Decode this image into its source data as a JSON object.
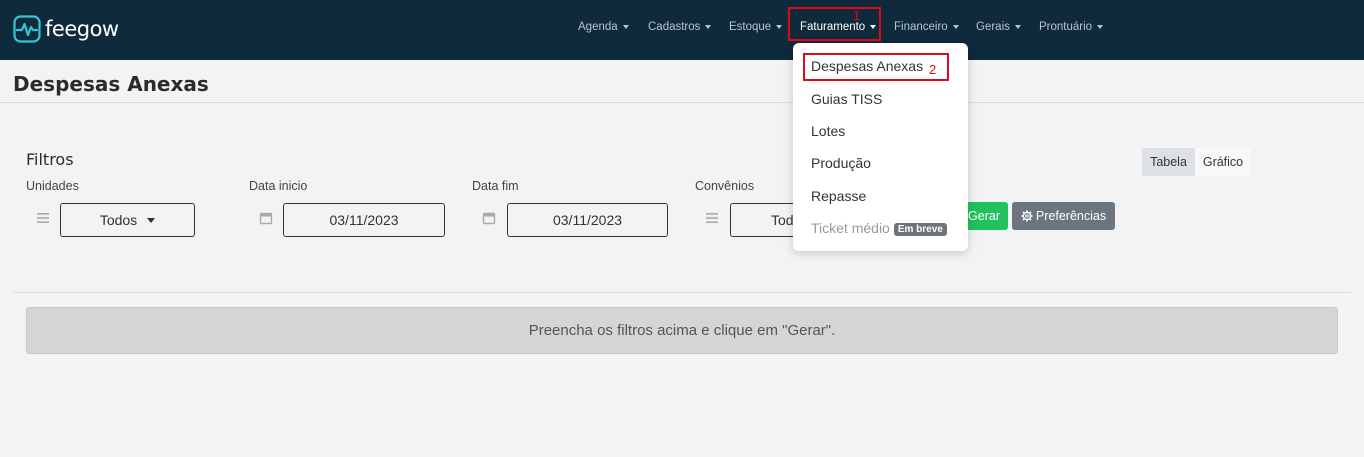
{
  "app": {
    "brand": "feegow"
  },
  "nav": {
    "items": [
      {
        "label": "Agenda",
        "active": false
      },
      {
        "label": "Cadastros",
        "active": false
      },
      {
        "label": "Estoque",
        "active": false
      },
      {
        "label": "Faturamento",
        "active": true
      },
      {
        "label": "Financeiro",
        "active": false
      },
      {
        "label": "Gerais",
        "active": false
      },
      {
        "label": "Prontuário",
        "active": false
      }
    ]
  },
  "annotations": {
    "step1": "1",
    "step2": "2"
  },
  "dropdown": {
    "items": [
      {
        "label": "Despesas Anexas"
      },
      {
        "label": "Guias TISS"
      },
      {
        "label": "Lotes"
      },
      {
        "label": "Produção"
      },
      {
        "label": "Repasse"
      },
      {
        "label": "Ticket médio",
        "badge": "Em breve",
        "disabled": true
      }
    ]
  },
  "page": {
    "title": "Despesas Anexas"
  },
  "filters": {
    "title": "Filtros",
    "unidades": {
      "label": "Unidades",
      "value": "Todos"
    },
    "data_inicio": {
      "label": "Data inicio",
      "value": "03/11/2023"
    },
    "data_fim": {
      "label": "Data fim",
      "value": "03/11/2023"
    },
    "convenios": {
      "label": "Convênios",
      "value": "Tod"
    }
  },
  "actions": {
    "gerar_label": "Gerar",
    "preferencias_label": "Preferências"
  },
  "view_toggle": {
    "tabela_label": "Tabela",
    "grafico_label": "Gráfico"
  },
  "message": "Preencha os filtros acima e clique em \"Gerar\".",
  "colors": {
    "topbar": "#0e2a3b",
    "highlight": "#e0081b",
    "gerar": "#21c25e",
    "preferencias": "#6c757d"
  }
}
